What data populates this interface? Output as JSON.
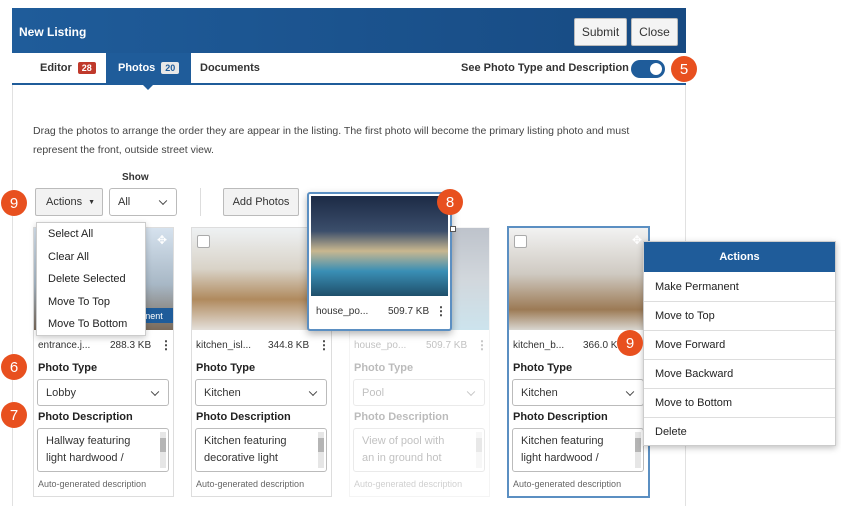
{
  "header": {
    "title": "New Listing",
    "submit_label": "Submit",
    "close_label": "Close"
  },
  "tabs": [
    {
      "label": "Editor",
      "badge": "28"
    },
    {
      "label": "Photos",
      "badge": "20"
    },
    {
      "label": "Documents"
    }
  ],
  "toggle": {
    "label": "See Photo Type and Description",
    "on": true
  },
  "instructions": "Drag the photos to arrange the order they are appear in the listing. The first photo will become the primary listing photo and must represent the front, outside street view.",
  "toolbar": {
    "actions_label": "Actions",
    "show_label": "Show",
    "show_value": "All",
    "add_photos_label": "Add Photos"
  },
  "markers": {
    "m5": "5",
    "m6": "6",
    "m7": "7",
    "m8": "8",
    "m9a": "9",
    "m9b": "9"
  },
  "actions_dropdown": [
    "Select All",
    "Clear All",
    "Delete Selected",
    "Move To Top",
    "Move To Bottom"
  ],
  "photo_type_label": "Photo Type",
  "photo_description_label": "Photo Description",
  "auto_desc_hint": "Auto-generated description",
  "cards": [
    {
      "filename": "entrance.j...",
      "size": "288.3 KB",
      "type": "Lobby",
      "desc_line1": "Hallway featuring",
      "desc_line2": "light hardwood /",
      "overlay": "nent"
    },
    {
      "filename": "kitchen_isl...",
      "size": "344.8 KB",
      "type": "Kitchen",
      "desc_line1": "Kitchen featuring",
      "desc_line2": "decorative light"
    },
    {
      "filename": "house_po...",
      "size": "509.7 KB",
      "type": "Pool",
      "desc_line1": "View of pool with",
      "desc_line2": "an in ground hot"
    },
    {
      "filename": "kitchen_b...",
      "size": "366.0 KB",
      "type": "Kitchen",
      "desc_line1": "Kitchen featuring",
      "desc_line2": "light hardwood /"
    }
  ],
  "drag_card": {
    "filename": "house_po...",
    "size": "509.7 KB"
  },
  "actions_menu": {
    "title": "Actions",
    "items": [
      "Make Permanent",
      "Move to Top",
      "Move Forward",
      "Move Backward",
      "Move to Bottom",
      "Delete"
    ]
  },
  "colors": {
    "brand": "#1f5c9a",
    "marker": "#e8501f",
    "badge_red": "#c0392b"
  }
}
